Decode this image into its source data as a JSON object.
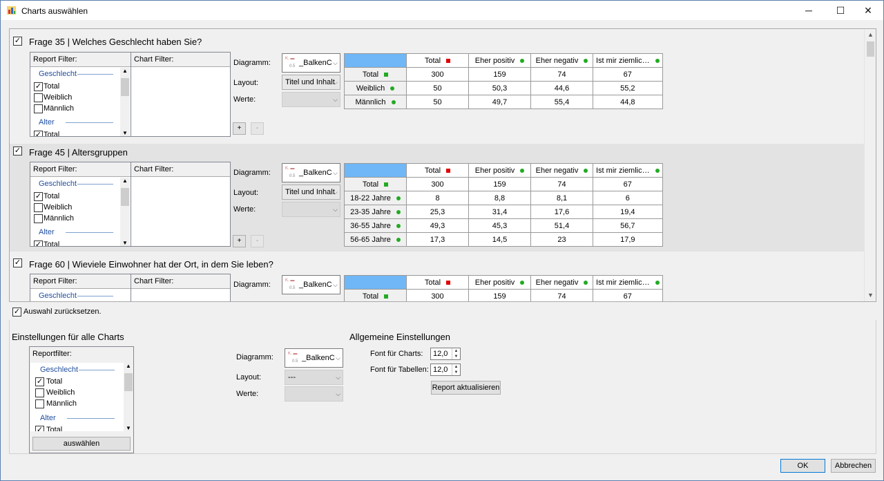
{
  "window": {
    "title": "Charts auswählen",
    "min": "─",
    "max": "☐",
    "close": "✕"
  },
  "common": {
    "report_filter": "Report Filter:",
    "chart_filter": "Chart Filter:",
    "diagramm": "Diagramm:",
    "layout": "Layout:",
    "werte": "Werte:",
    "diagram_value": "_BalkenC",
    "diagram_mini_top": "K. ▬",
    "diagram_mini_bot": "0.5",
    "layout_value": "Titel und Inhalt",
    "plus": "+",
    "minus": "-",
    "grp_geschlecht": "Geschlecht",
    "grp_alter": "Alter",
    "item_total": "Total",
    "item_weiblich": "Weiblich",
    "item_maennlich": "Männlich"
  },
  "table_header": [
    "",
    "Total",
    "Eher positiv",
    "Eher negativ",
    "Ist mir ziemlic…"
  ],
  "sections": [
    {
      "title": "Frage 35 | Welches Geschlecht haben Sie?",
      "checked": "✓",
      "rows": [
        [
          "Total",
          "300",
          "159",
          "74",
          "67"
        ],
        [
          "Weiblich",
          "50",
          "50,3",
          "44,6",
          "55,2"
        ],
        [
          "Männlich",
          "50",
          "49,7",
          "55,4",
          "44,8"
        ]
      ]
    },
    {
      "title": "Frage 45 | Altersgruppen",
      "checked": "✓",
      "rows": [
        [
          "Total",
          "300",
          "159",
          "74",
          "67"
        ],
        [
          "18-22 Jahre",
          "8",
          "8,8",
          "8,1",
          "6"
        ],
        [
          "23-35 Jahre",
          "25,3",
          "31,4",
          "17,6",
          "19,4"
        ],
        [
          "36-55 Jahre",
          "49,3",
          "45,3",
          "51,4",
          "56,7"
        ],
        [
          "56-65 Jahre",
          "17,3",
          "14,5",
          "23",
          "17,9"
        ]
      ]
    },
    {
      "title": "Frage 60 | Wieviele Einwohner hat der Ort, in dem Sie leben?",
      "checked": "✓",
      "rows": [
        [
          "Total",
          "300",
          "159",
          "74",
          "67"
        ]
      ]
    }
  ],
  "reset": {
    "label": "Auswahl zurücksetzen.",
    "checked": "✓"
  },
  "global": {
    "heading": "Einstellungen für alle Charts",
    "reportfilter": "Reportfilter:",
    "select_btn": "auswählen",
    "layout_value": "---"
  },
  "general": {
    "heading": "Allgemeine Einstellungen",
    "font_charts_label": "Font für Charts:",
    "font_charts_value": "12,0",
    "font_tables_label": "Font für Tabellen:",
    "font_tables_value": "12,0",
    "update_btn": "Report aktualisieren"
  },
  "footer": {
    "ok": "OK",
    "cancel": "Abbrechen"
  }
}
